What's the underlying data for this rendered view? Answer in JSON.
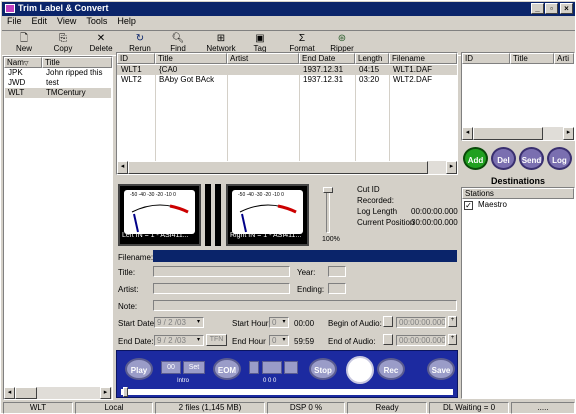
{
  "window": {
    "title": "Trim Label & Convert"
  },
  "menu": [
    "File",
    "Edit",
    "View",
    "Tools",
    "Help"
  ],
  "toolbar": [
    {
      "label": "New",
      "icon": "new-icon"
    },
    {
      "label": "Copy",
      "icon": "copy-icon"
    },
    {
      "label": "Delete",
      "icon": "delete-icon"
    },
    {
      "label": "Rerun",
      "icon": "rerun-icon"
    },
    {
      "label": "Find",
      "icon": "find-icon"
    },
    {
      "label": "Network",
      "icon": "network-icon"
    },
    {
      "label": "Tag",
      "icon": "tag-icon"
    },
    {
      "label": "Format",
      "icon": "sigma-icon"
    },
    {
      "label": "Ripper",
      "icon": "ripper-icon"
    }
  ],
  "left_list": {
    "headers": [
      "Nam",
      "Title"
    ],
    "rows": [
      {
        "name": "JPK",
        "title": "John ripped this"
      },
      {
        "name": "JWD",
        "title": "test"
      },
      {
        "name": "WLT",
        "title": "TMCentury"
      }
    ]
  },
  "files_table": {
    "headers": [
      "ID",
      "Title",
      "Artist",
      "End Date",
      "Length",
      "Filename"
    ],
    "rows": [
      {
        "id": "WLT1",
        "title": "{CA0",
        "artist": "",
        "end_date": "1937.12.31",
        "length": "04:15",
        "filename": "WLT1.DAF"
      },
      {
        "id": "WLT2",
        "title": "BAby Got BAck",
        "artist": "",
        "end_date": "1937.12.31",
        "length": "03:20",
        "filename": "WLT2.DAF"
      }
    ]
  },
  "right_table": {
    "headers": [
      "ID",
      "Title",
      "Arti"
    ]
  },
  "action_buttons": [
    "Add",
    "Del",
    "Send",
    "Log"
  ],
  "destinations": {
    "title": "Destinations",
    "header": "Stations",
    "items": [
      {
        "label": "Maestro",
        "checked": true
      }
    ]
  },
  "meters": {
    "left_label": "Left IN = 1 - ASI411...",
    "right_label": "Right IN = 1 - ASI411...",
    "scale": "-50 -40 -30 -20 -10 0",
    "level_pct": "100%"
  },
  "cut_info": {
    "cut_id": "Cut ID",
    "recorded": "Recorded:",
    "log_length_label": "Log Length",
    "log_length": "00:00:00.000",
    "current_position_label": "Current Position",
    "current_position": "30:00:00.000"
  },
  "form": {
    "filename_label": "Filename:",
    "title_label": "Title:",
    "artist_label": "Artist:",
    "note_label": "Note:",
    "year_label": "Year:",
    "ending_label": "Ending:",
    "start_date_label": "Start Date:",
    "start_date": "9 / 2 /03",
    "end_date_label": "End Date:",
    "end_date": "9 / 2 /03",
    "tfn": "TFN",
    "start_hour_label": "Start Hour",
    "start_hour": "0",
    "start_time": "00:00",
    "end_hour_label": "End Hour",
    "end_hour": "0",
    "end_time": "59:59",
    "begin_audio_label": "Begin of Audio:",
    "begin_audio": "00:00:00.000",
    "end_audio_label": "End of Audio:",
    "end_audio": "00:00:00.000"
  },
  "transport": {
    "play": "Play",
    "set": "Set",
    "intro": "Intro",
    "intro_value": "00",
    "eom": "EOM",
    "eom_value": "0 0 0",
    "stop": "Stop",
    "rec": "Rec",
    "save": "Save"
  },
  "status": [
    "WLT",
    "Local",
    "2 files (1,145 MB)",
    "DSP 0 %",
    "Ready",
    "DL Waiting = 0",
    "....."
  ]
}
